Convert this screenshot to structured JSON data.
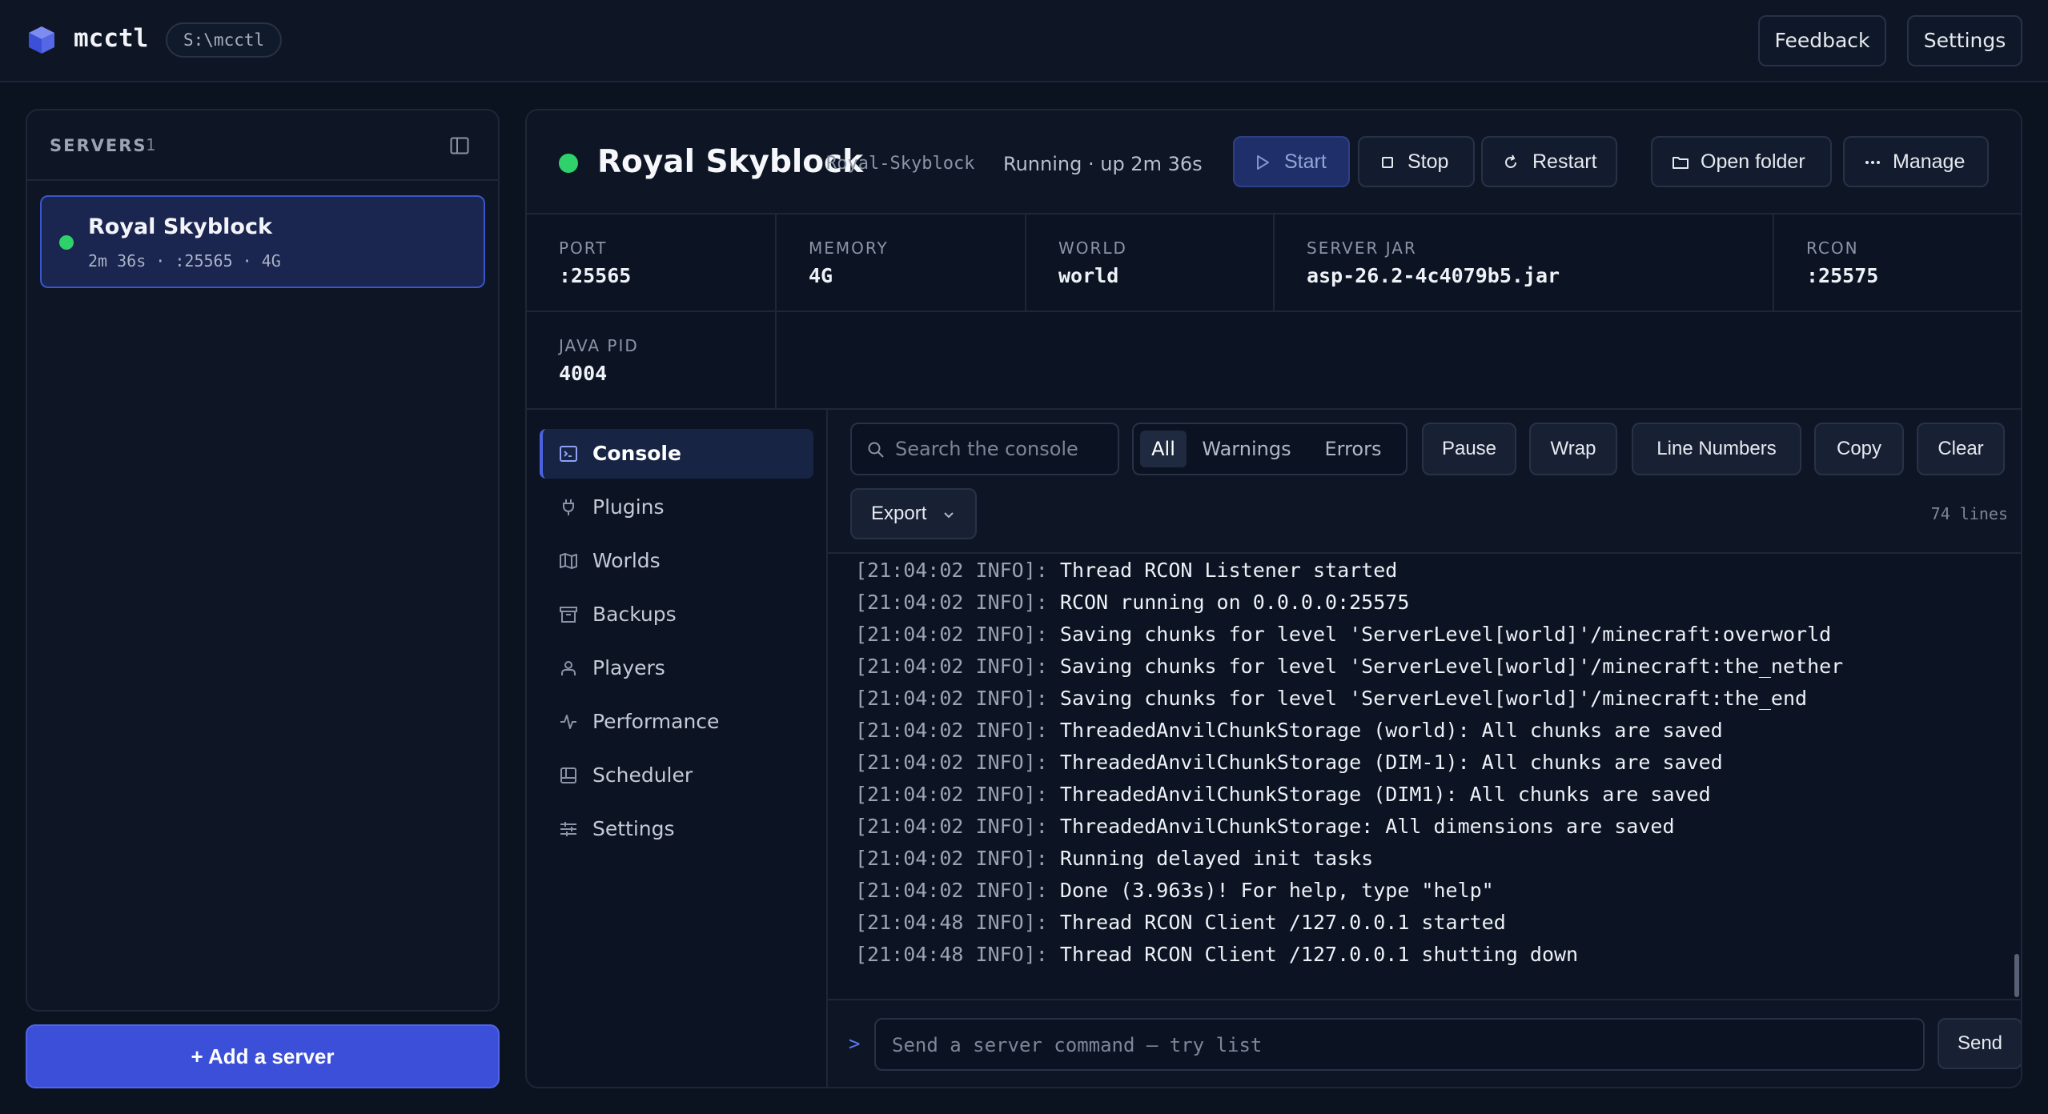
{
  "app": {
    "name": "mcctl",
    "path": "S:\\mcctl"
  },
  "topbar": {
    "feedback_label": "Feedback",
    "settings_label": "Settings"
  },
  "sidebar": {
    "title": "SERVERS",
    "count": "1",
    "servers": [
      {
        "name": "Royal Skyblock",
        "meta": "2m 36s · :25565 · 4G",
        "status": "running"
      }
    ],
    "add_label": "Add a server"
  },
  "server": {
    "title": "Royal Skyblock",
    "id": "Royal-Skyblock",
    "status": "Running · up 2m 36s",
    "actions": {
      "start": "Start",
      "stop": "Stop",
      "restart": "Restart",
      "open_folder": "Open folder",
      "manage": "Manage"
    },
    "stats": [
      {
        "label": "PORT",
        "value": ":25565"
      },
      {
        "label": "MEMORY",
        "value": "4G"
      },
      {
        "label": "WORLD",
        "value": "world"
      },
      {
        "label": "SERVER JAR",
        "value": "asp-26.2-4c4079b5.jar"
      },
      {
        "label": "RCON",
        "value": ":25575"
      },
      {
        "label": "JAVA PID",
        "value": "4004"
      }
    ]
  },
  "nav": {
    "items": [
      {
        "label": "Console",
        "icon": "terminal-icon",
        "active": true
      },
      {
        "label": "Plugins",
        "icon": "plug-icon"
      },
      {
        "label": "Worlds",
        "icon": "map-icon"
      },
      {
        "label": "Backups",
        "icon": "archive-icon"
      },
      {
        "label": "Players",
        "icon": "user-icon"
      },
      {
        "label": "Performance",
        "icon": "activity-icon"
      },
      {
        "label": "Scheduler",
        "icon": "calendar-icon"
      },
      {
        "label": "Settings",
        "icon": "sliders-icon"
      }
    ]
  },
  "console": {
    "search_placeholder": "Search the console",
    "filters": [
      "All",
      "Warnings",
      "Errors"
    ],
    "active_filter": "All",
    "buttons": {
      "pause": "Pause",
      "wrap": "Wrap",
      "line_numbers": "Line Numbers",
      "copy": "Copy",
      "clear": "Clear"
    },
    "export_label": "Export",
    "line_count": "74 lines",
    "lines": [
      {
        "ts": "[21:04:02 INFO]:",
        "msg": "Thread RCON Listener started"
      },
      {
        "ts": "[21:04:02 INFO]:",
        "msg": "RCON running on 0.0.0.0:25575"
      },
      {
        "ts": "[21:04:02 INFO]:",
        "msg": "Saving chunks for level 'ServerLevel[world]'/minecraft:overworld"
      },
      {
        "ts": "[21:04:02 INFO]:",
        "msg": "Saving chunks for level 'ServerLevel[world]'/minecraft:the_nether"
      },
      {
        "ts": "[21:04:02 INFO]:",
        "msg": "Saving chunks for level 'ServerLevel[world]'/minecraft:the_end"
      },
      {
        "ts": "[21:04:02 INFO]:",
        "msg": "ThreadedAnvilChunkStorage (world): All chunks are saved"
      },
      {
        "ts": "[21:04:02 INFO]:",
        "msg": "ThreadedAnvilChunkStorage (DIM-1): All chunks are saved"
      },
      {
        "ts": "[21:04:02 INFO]:",
        "msg": "ThreadedAnvilChunkStorage (DIM1): All chunks are saved"
      },
      {
        "ts": "[21:04:02 INFO]:",
        "msg": "ThreadedAnvilChunkStorage: All dimensions are saved"
      },
      {
        "ts": "[21:04:02 INFO]:",
        "msg": "Running delayed init tasks"
      },
      {
        "ts": "[21:04:02 INFO]:",
        "msg": "Done (3.963s)! For help, type \"help\""
      },
      {
        "ts": "[21:04:48 INFO]:",
        "msg": "Thread RCON Client /127.0.0.1 started"
      },
      {
        "ts": "[21:04:48 INFO]:",
        "msg": "Thread RCON Client /127.0.0.1 shutting down"
      }
    ],
    "prompt": ">",
    "command_placeholder": "Send a server command — try list",
    "send_label": "Send"
  },
  "colors": {
    "accent": "#3b4fd8",
    "running": "#2fd26a",
    "background": "#0b1220"
  }
}
